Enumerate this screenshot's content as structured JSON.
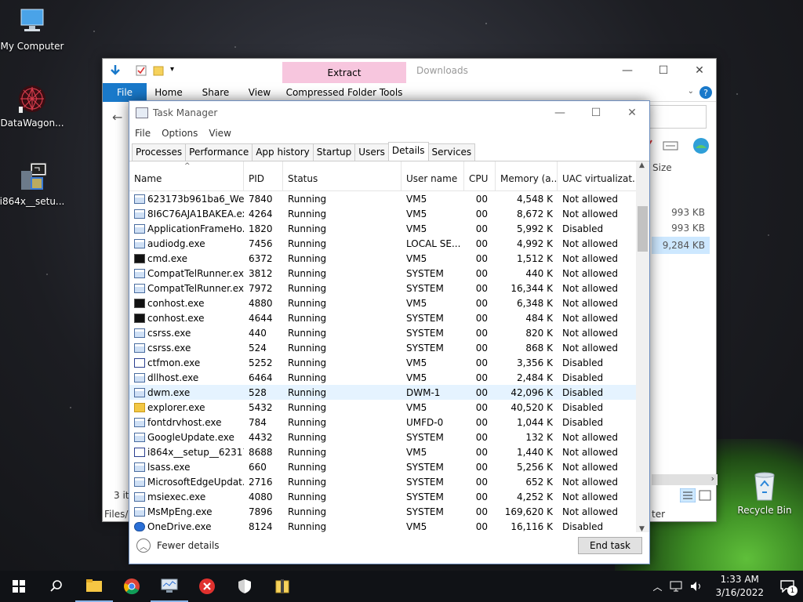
{
  "desktop": {
    "icons": [
      {
        "label": "My Computer",
        "icon": "computer-icon"
      },
      {
        "label": "DataWagon...",
        "icon": "datawagon-icon"
      },
      {
        "label": "i864x__setu...",
        "icon": "installer-icon"
      },
      {
        "label": "Recycle Bin",
        "icon": "recycle-bin-icon"
      }
    ]
  },
  "explorer": {
    "title": "Downloads",
    "context_tab": "Extract",
    "ribbon_tabs": [
      "File",
      "Home",
      "Share",
      "View",
      "Compressed Folder Tools"
    ],
    "size_header": "Size",
    "sizes": [
      "993 KB",
      "993 KB",
      "9,284 KB"
    ],
    "status_count": "3 ite",
    "status_path": "Files/F",
    "partial_text": "ter"
  },
  "taskmanager": {
    "title": "Task Manager",
    "menu": [
      "File",
      "Options",
      "View"
    ],
    "tabs": [
      "Processes",
      "Performance",
      "App history",
      "Startup",
      "Users",
      "Details",
      "Services"
    ],
    "active_tab": "Details",
    "columns": [
      "Name",
      "PID",
      "Status",
      "User name",
      "CPU",
      "Memory (a...",
      "UAC virtualizat..."
    ],
    "rows": [
      {
        "name": "623173b961ba6_Wed...",
        "pid": "7840",
        "status": "Running",
        "user": "VM5",
        "cpu": "00",
        "mem": "4,548 K",
        "uac": "Not allowed",
        "icon": "window"
      },
      {
        "name": "8I6C76AJA1BAKEA.exe",
        "pid": "4264",
        "status": "Running",
        "user": "VM5",
        "cpu": "00",
        "mem": "8,672 K",
        "uac": "Not allowed",
        "icon": "window"
      },
      {
        "name": "ApplicationFrameHo...",
        "pid": "1820",
        "status": "Running",
        "user": "VM5",
        "cpu": "00",
        "mem": "5,992 K",
        "uac": "Disabled",
        "icon": "window"
      },
      {
        "name": "audiodg.exe",
        "pid": "7456",
        "status": "Running",
        "user": "LOCAL SE...",
        "cpu": "00",
        "mem": "4,992 K",
        "uac": "Not allowed",
        "icon": "window"
      },
      {
        "name": "cmd.exe",
        "pid": "6372",
        "status": "Running",
        "user": "VM5",
        "cpu": "00",
        "mem": "1,512 K",
        "uac": "Not allowed",
        "icon": "cmd"
      },
      {
        "name": "CompatTelRunner.exe",
        "pid": "3812",
        "status": "Running",
        "user": "SYSTEM",
        "cpu": "00",
        "mem": "440 K",
        "uac": "Not allowed",
        "icon": "window"
      },
      {
        "name": "CompatTelRunner.exe",
        "pid": "7972",
        "status": "Running",
        "user": "SYSTEM",
        "cpu": "00",
        "mem": "16,344 K",
        "uac": "Not allowed",
        "icon": "window"
      },
      {
        "name": "conhost.exe",
        "pid": "4880",
        "status": "Running",
        "user": "VM5",
        "cpu": "00",
        "mem": "6,348 K",
        "uac": "Not allowed",
        "icon": "cmd"
      },
      {
        "name": "conhost.exe",
        "pid": "4644",
        "status": "Running",
        "user": "SYSTEM",
        "cpu": "00",
        "mem": "484 K",
        "uac": "Not allowed",
        "icon": "cmd"
      },
      {
        "name": "csrss.exe",
        "pid": "440",
        "status": "Running",
        "user": "SYSTEM",
        "cpu": "00",
        "mem": "820 K",
        "uac": "Not allowed",
        "icon": "window"
      },
      {
        "name": "csrss.exe",
        "pid": "524",
        "status": "Running",
        "user": "SYSTEM",
        "cpu": "00",
        "mem": "868 K",
        "uac": "Not allowed",
        "icon": "window"
      },
      {
        "name": "ctfmon.exe",
        "pid": "5252",
        "status": "Running",
        "user": "VM5",
        "cpu": "00",
        "mem": "3,356 K",
        "uac": "Disabled",
        "icon": "pen"
      },
      {
        "name": "dllhost.exe",
        "pid": "6464",
        "status": "Running",
        "user": "VM5",
        "cpu": "00",
        "mem": "2,484 K",
        "uac": "Disabled",
        "icon": "window"
      },
      {
        "name": "dwm.exe",
        "pid": "528",
        "status": "Running",
        "user": "DWM-1",
        "cpu": "00",
        "mem": "42,096 K",
        "uac": "Disabled",
        "icon": "window"
      },
      {
        "name": "explorer.exe",
        "pid": "5432",
        "status": "Running",
        "user": "VM5",
        "cpu": "00",
        "mem": "40,520 K",
        "uac": "Disabled",
        "icon": "folder"
      },
      {
        "name": "fontdrvhost.exe",
        "pid": "784",
        "status": "Running",
        "user": "UMFD-0",
        "cpu": "00",
        "mem": "1,044 K",
        "uac": "Disabled",
        "icon": "window"
      },
      {
        "name": "GoogleUpdate.exe",
        "pid": "4432",
        "status": "Running",
        "user": "SYSTEM",
        "cpu": "00",
        "mem": "132 K",
        "uac": "Not allowed",
        "icon": "window"
      },
      {
        "name": "i864x__setup__62317...",
        "pid": "8688",
        "status": "Running",
        "user": "VM5",
        "cpu": "00",
        "mem": "1,440 K",
        "uac": "Not allowed",
        "icon": "pen"
      },
      {
        "name": "lsass.exe",
        "pid": "660",
        "status": "Running",
        "user": "SYSTEM",
        "cpu": "00",
        "mem": "5,256 K",
        "uac": "Not allowed",
        "icon": "window"
      },
      {
        "name": "MicrosoftEdgeUpdat...",
        "pid": "2716",
        "status": "Running",
        "user": "SYSTEM",
        "cpu": "00",
        "mem": "652 K",
        "uac": "Not allowed",
        "icon": "window"
      },
      {
        "name": "msiexec.exe",
        "pid": "4080",
        "status": "Running",
        "user": "SYSTEM",
        "cpu": "00",
        "mem": "4,252 K",
        "uac": "Not allowed",
        "icon": "window"
      },
      {
        "name": "MsMpEng.exe",
        "pid": "7896",
        "status": "Running",
        "user": "SYSTEM",
        "cpu": "00",
        "mem": "169,620 K",
        "uac": "Not allowed",
        "icon": "window"
      },
      {
        "name": "OneDrive.exe",
        "pid": "8124",
        "status": "Running",
        "user": "VM5",
        "cpu": "00",
        "mem": "16,116 K",
        "uac": "Disabled",
        "icon": "blue"
      }
    ],
    "selected_row": 13,
    "footer": {
      "fewer_details": "Fewer details",
      "end_task": "End task"
    }
  },
  "taskbar": {
    "time": "1:33 AM",
    "date": "3/16/2022",
    "notification_count": "1"
  }
}
